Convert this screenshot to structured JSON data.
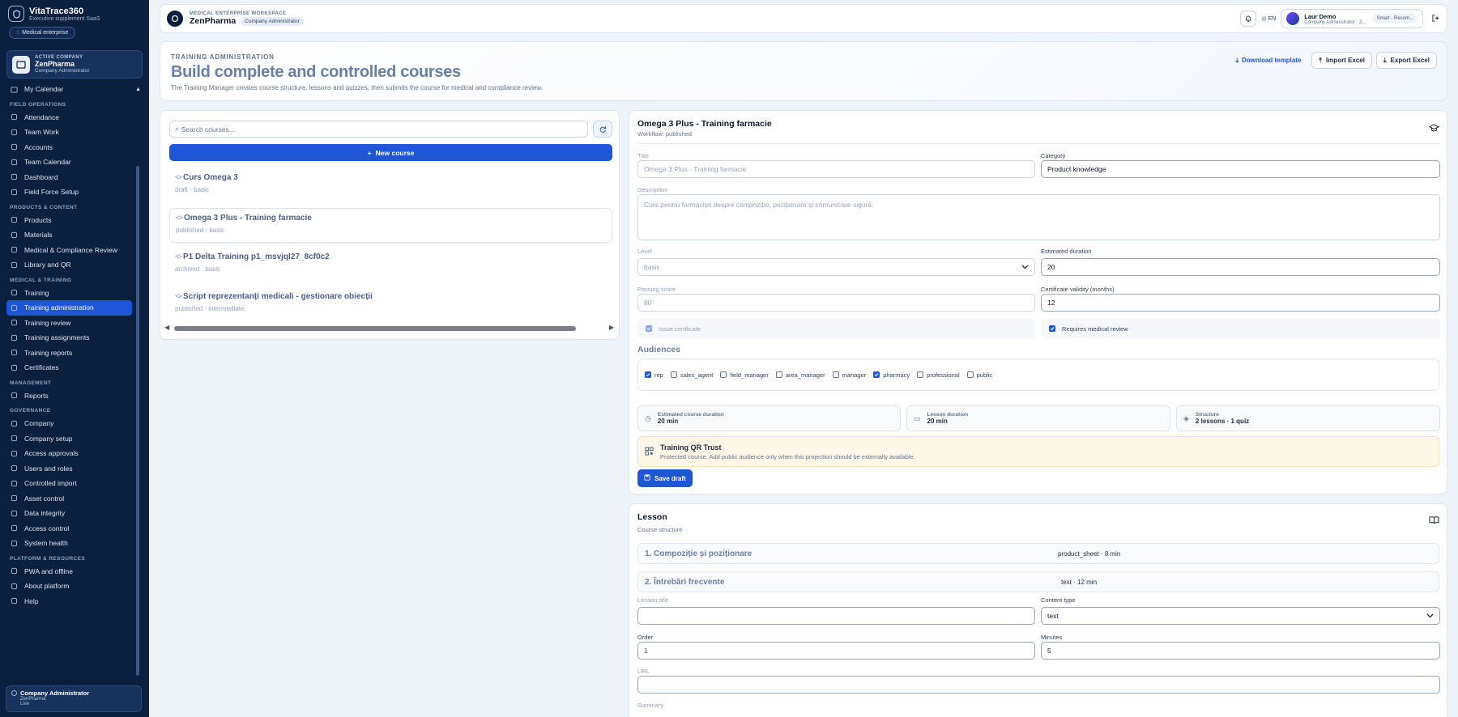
{
  "sidebar": {
    "brand_title": "VitaTrace360",
    "brand_sub": "Executive supplement SaaS",
    "tag": "Medical enterprise",
    "company": {
      "label": "ACTIVE COMPANY",
      "name": "ZenPharma",
      "role": "Company Administrator"
    },
    "calendar": "My Calendar",
    "sections": {
      "field": "FIELD OPERATIONS",
      "products": "PRODUCTS & CONTENT",
      "medical": "MEDICAL & TRAINING",
      "management": "MANAGEMENT",
      "governance": "GOVERNANCE",
      "platform": "PLATFORM & RESOURCES"
    },
    "field_items": [
      "Attendance",
      "Team Work",
      "Accounts",
      "Team Calendar",
      "Dashboard",
      "Field Force Setup"
    ],
    "product_items": [
      "Products",
      "Materials",
      "Medical & Compliance Review",
      "Library and QR"
    ],
    "medical_items": [
      "Training",
      "Training administration",
      "Training review",
      "Training assignments",
      "Training reports",
      "Certificates"
    ],
    "management_items": [
      "Reports"
    ],
    "governance_items": [
      "Company",
      "Company setup",
      "Access approvals",
      "Users and roles",
      "Controlled import",
      "Asset control",
      "Data integrity",
      "Access control",
      "System health"
    ],
    "platform_items": [
      "PWA and offline",
      "About platform",
      "Help"
    ],
    "footer": {
      "title": "Company Administrator",
      "line1": "ZenPharma",
      "line2": "Live"
    }
  },
  "topbar": {
    "label": "MEDICAL ENTERPRISE WORKSPACE",
    "name": "ZenPharma",
    "role_pill": "Company Administrator",
    "lang": "EN",
    "user_name": "Laur Demo",
    "user_sub": "Company Administrator · Z...",
    "smart": "Smart · Recom..."
  },
  "header": {
    "label": "TRAINING ADMINISTRATION",
    "title": "Build complete and controlled courses",
    "desc": "The Training Manager creates course structure, lessons and quizzes, then submits the course for medical and compliance review.",
    "download": "Download template",
    "import": "Import Excel",
    "export": "Export Excel"
  },
  "courses": {
    "search_placeholder": "Search courses...",
    "new_label": "New course",
    "items": [
      {
        "title": "Curs Omega 3",
        "meta": "draft · basic"
      },
      {
        "title": "Omega 3 Plus - Training farmacie",
        "meta": "published · basic"
      },
      {
        "title": "P1 Delta Training p1_msvjql27_8cf0c2",
        "meta": "archived · basic"
      },
      {
        "title": "Script reprezentanți medicali - gestionare obiecții",
        "meta": "published · intermediate"
      }
    ]
  },
  "editor": {
    "title": "Omega 3 Plus - Training farmacie",
    "workflow": "Workflow: published",
    "labels": {
      "title": "Title",
      "category": "Category",
      "description": "Description",
      "level": "Level",
      "duration": "Estimated duration",
      "passing": "Passing score",
      "validity": "Certificate validity (months)"
    },
    "values": {
      "title": "Omega 3 Plus - Training farmacie",
      "category": "Product knowledge",
      "description": "Curs pentru farmaciști despre compoziție, poziționare și comunicare sigură.",
      "level": "basic",
      "duration": "20",
      "passing": "80",
      "validity": "12"
    },
    "issue_certificate": "Issue certificate",
    "requires_review": "Requires medical review",
    "audiences_title": "Audiences",
    "audiences": [
      {
        "name": "rep",
        "checked": true
      },
      {
        "name": "sales_agent",
        "checked": false
      },
      {
        "name": "field_manager",
        "checked": false
      },
      {
        "name": "area_manager",
        "checked": false
      },
      {
        "name": "manager",
        "checked": false
      },
      {
        "name": "pharmacy",
        "checked": true
      },
      {
        "name": "professional",
        "checked": false
      },
      {
        "name": "public",
        "checked": false
      }
    ],
    "stats": [
      {
        "label": "Estimated course duration",
        "value": "20 min"
      },
      {
        "label": "Lesson duration",
        "value": "20 min"
      },
      {
        "label": "Structure",
        "value": "2 lessons · 1 quiz"
      }
    ],
    "qr_title": "Training QR Trust",
    "qr_desc": "Protected course. Add public audience only when this projection should be externally available.",
    "save": "Save draft"
  },
  "lesson": {
    "title": "Lesson",
    "sub": "Course structure",
    "rows": [
      {
        "title": "1. Compoziție și poziționare",
        "meta": "product_sheet · 8 min"
      },
      {
        "title": "2. Întrebări frecvente",
        "meta": "text · 12 min"
      }
    ],
    "labels": {
      "title": "Lesson title",
      "content_type": "Content type",
      "order": "Order",
      "minutes": "Minutes",
      "url": "URL",
      "summary": "Summary"
    },
    "values": {
      "content_type": "text",
      "order": "1",
      "minutes": "5"
    }
  }
}
